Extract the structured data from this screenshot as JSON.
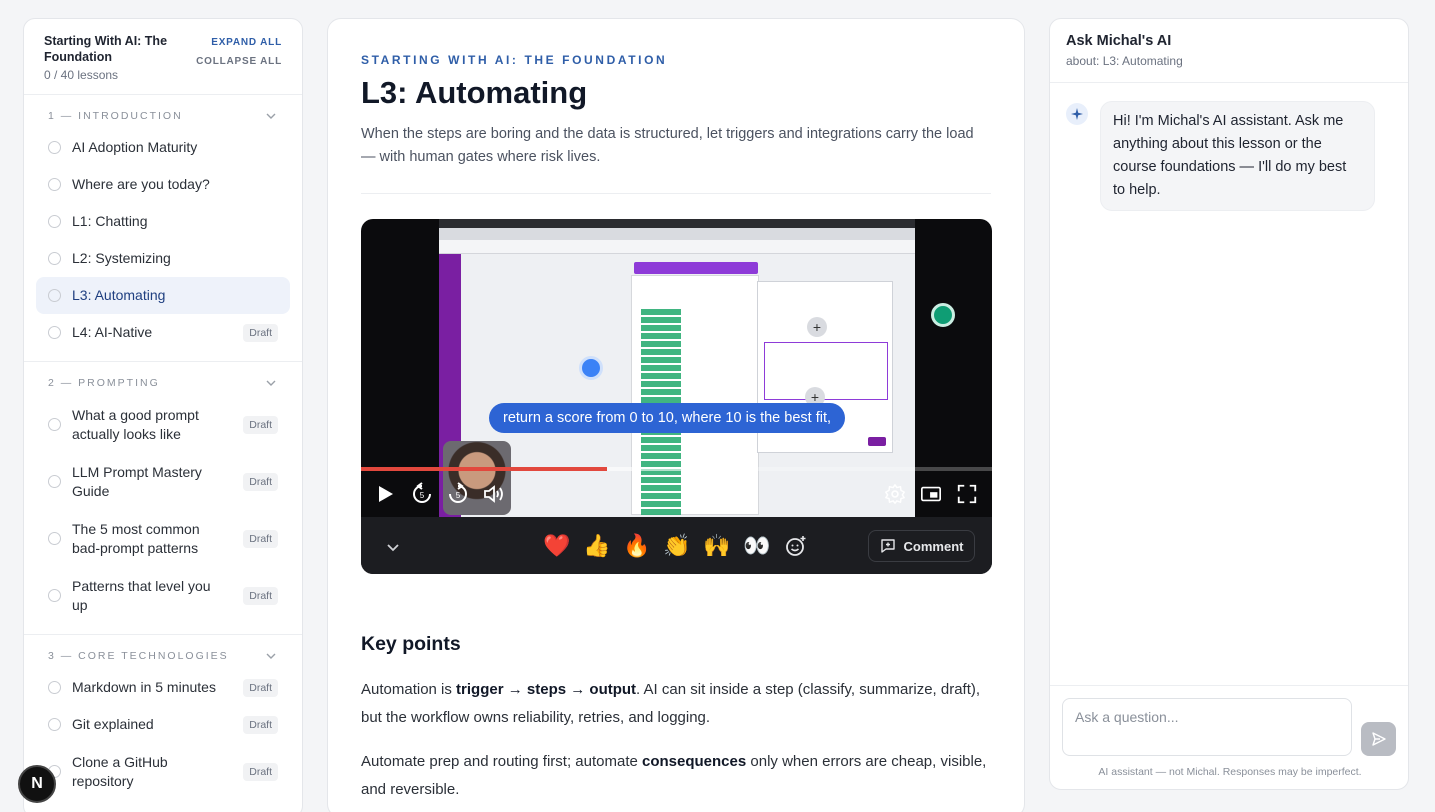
{
  "sidebar": {
    "course_title": "Starting With AI: The Foundation",
    "progress": "0 / 40 lessons",
    "expand_all": "EXPAND ALL",
    "collapse_all": "COLLAPSE ALL",
    "draft_label": "Draft",
    "sections": [
      {
        "label": "1 — INTRODUCTION",
        "lessons": [
          {
            "label": "AI Adoption Maturity",
            "draft": false
          },
          {
            "label": "Where are you today?",
            "draft": false
          },
          {
            "label": "L1: Chatting",
            "draft": false
          },
          {
            "label": "L2: Systemizing",
            "draft": false
          },
          {
            "label": "L3: Automating",
            "draft": false,
            "active": true
          },
          {
            "label": "L4: AI-Native",
            "draft": true
          }
        ]
      },
      {
        "label": "2 — PROMPTING",
        "lessons": [
          {
            "label": "What a good prompt actually looks like",
            "draft": true
          },
          {
            "label": "LLM Prompt Mastery Guide",
            "draft": true
          },
          {
            "label": "The 5 most common bad-prompt patterns",
            "draft": true
          },
          {
            "label": "Patterns that level you up",
            "draft": true
          }
        ]
      },
      {
        "label": "3 — CORE TECHNOLOGIES",
        "lessons": [
          {
            "label": "Markdown in 5 minutes",
            "draft": true
          },
          {
            "label": "Git explained",
            "draft": true
          },
          {
            "label": "Clone a GitHub repository",
            "draft": true
          }
        ]
      }
    ]
  },
  "badge": {
    "letter": "N"
  },
  "main": {
    "eyebrow": "STARTING WITH AI: THE FOUNDATION",
    "title": "L3: Automating",
    "subtitle": "When the steps are boring and the data is structured, let triggers and integrations carry the load — with human gates where risk lives.",
    "video": {
      "caption": "return a score from 0 to 10, where 10 is the best fit,",
      "played_fraction": 0.39,
      "buffered_fraction": 0.56,
      "skip_back_label": "5",
      "skip_forward_label": "5",
      "reactions": [
        "❤️",
        "👍",
        "🔥",
        "👏",
        "🙌",
        "👀"
      ],
      "comment_label": "Comment"
    },
    "key_points_title": "Key points",
    "paragraphs": [
      {
        "pre": "Automation is ",
        "bold": "trigger → steps → output",
        "post": ". AI can sit inside a step (classify, summarize, draft), but the workflow owns reliability, retries, and logging."
      },
      {
        "pre": "Automate prep and routing first; automate ",
        "bold": "consequences",
        "post": " only when errors are cheap, visible, and reversible."
      }
    ]
  },
  "chat": {
    "title": "Ask Michal's AI",
    "subtitle": "about: L3: Automating",
    "greeting": "Hi! I'm Michal's AI assistant. Ask me anything about this lesson or the course foundations — I'll do my best to help.",
    "input_placeholder": "Ask a question...",
    "disclaimer": "AI assistant — not Michal. Responses may be imperfect."
  },
  "colors": {
    "accent": "#2f5ea8",
    "active_bg": "#eef2fa",
    "caption_bg": "#2d64d4",
    "progress_played": "#e2483d"
  }
}
